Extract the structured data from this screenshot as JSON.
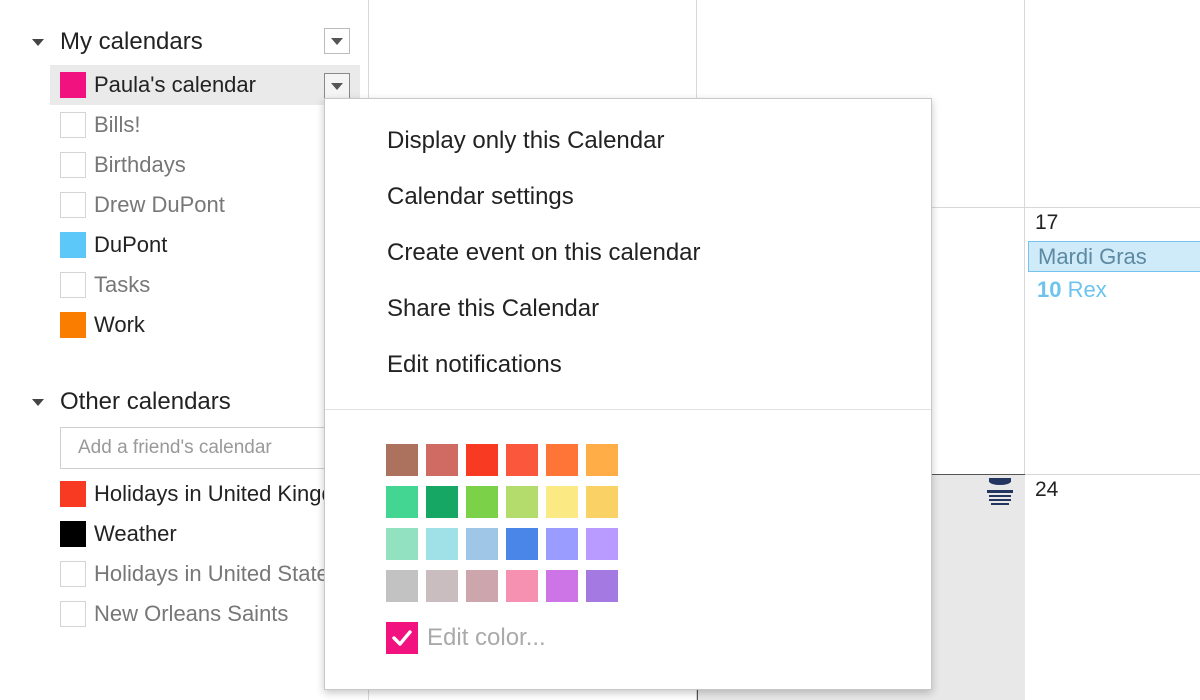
{
  "sidebar": {
    "my_calendars": {
      "title": "My calendars",
      "items": [
        {
          "label": "Paula's calendar",
          "color": "#f1127f"
        },
        {
          "label": "Bills!",
          "color": null
        },
        {
          "label": "Birthdays",
          "color": null
        },
        {
          "label": "Drew DuPont",
          "color": null
        },
        {
          "label": "DuPont",
          "color": "#5cc8fa"
        },
        {
          "label": "Tasks",
          "color": null
        },
        {
          "label": "Work",
          "color": "#fb7d00"
        }
      ]
    },
    "other_calendars": {
      "title": "Other calendars",
      "add_placeholder": "Add a friend's calendar",
      "items": [
        {
          "label": "Holidays in United Kingdom",
          "color": "#f83a22"
        },
        {
          "label": "Weather",
          "color": "#000000"
        },
        {
          "label": "Holidays in United States",
          "color": null
        },
        {
          "label": "New Orleans Saints",
          "color": null
        }
      ]
    }
  },
  "context_menu": {
    "items": [
      "Display only this Calendar",
      "Calendar settings",
      "Create event on this calendar",
      "Share this Calendar",
      "Edit notifications"
    ],
    "palette": [
      [
        "#ac725e",
        "#d06b64",
        "#f83a22",
        "#fa573c",
        "#ff7537",
        "#ffad46"
      ],
      [
        "#42d692",
        "#16a765",
        "#7bd148",
        "#b3dc6c",
        "#fbe983",
        "#fad165"
      ],
      [
        "#92e1c0",
        "#9fe1e7",
        "#9fc6e7",
        "#4986e7",
        "#9a9cff",
        "#b99aff"
      ],
      [
        "#c2c2c2",
        "#cabdbf",
        "#cca6ac",
        "#f691b2",
        "#cd74e6",
        "#a47ae2"
      ]
    ],
    "selected_color": "#f1127f",
    "edit_color_label": "Edit color..."
  },
  "calendar": {
    "days": {
      "d17": "17",
      "d24": "24"
    },
    "events": {
      "allday": "Mardi Gras",
      "timed_time": "10",
      "timed_title": "Rex"
    },
    "colors": {
      "event_bg": "#cfeaf8",
      "event_border": "#74c4ef",
      "timed_text": "#6cc4ee"
    }
  }
}
